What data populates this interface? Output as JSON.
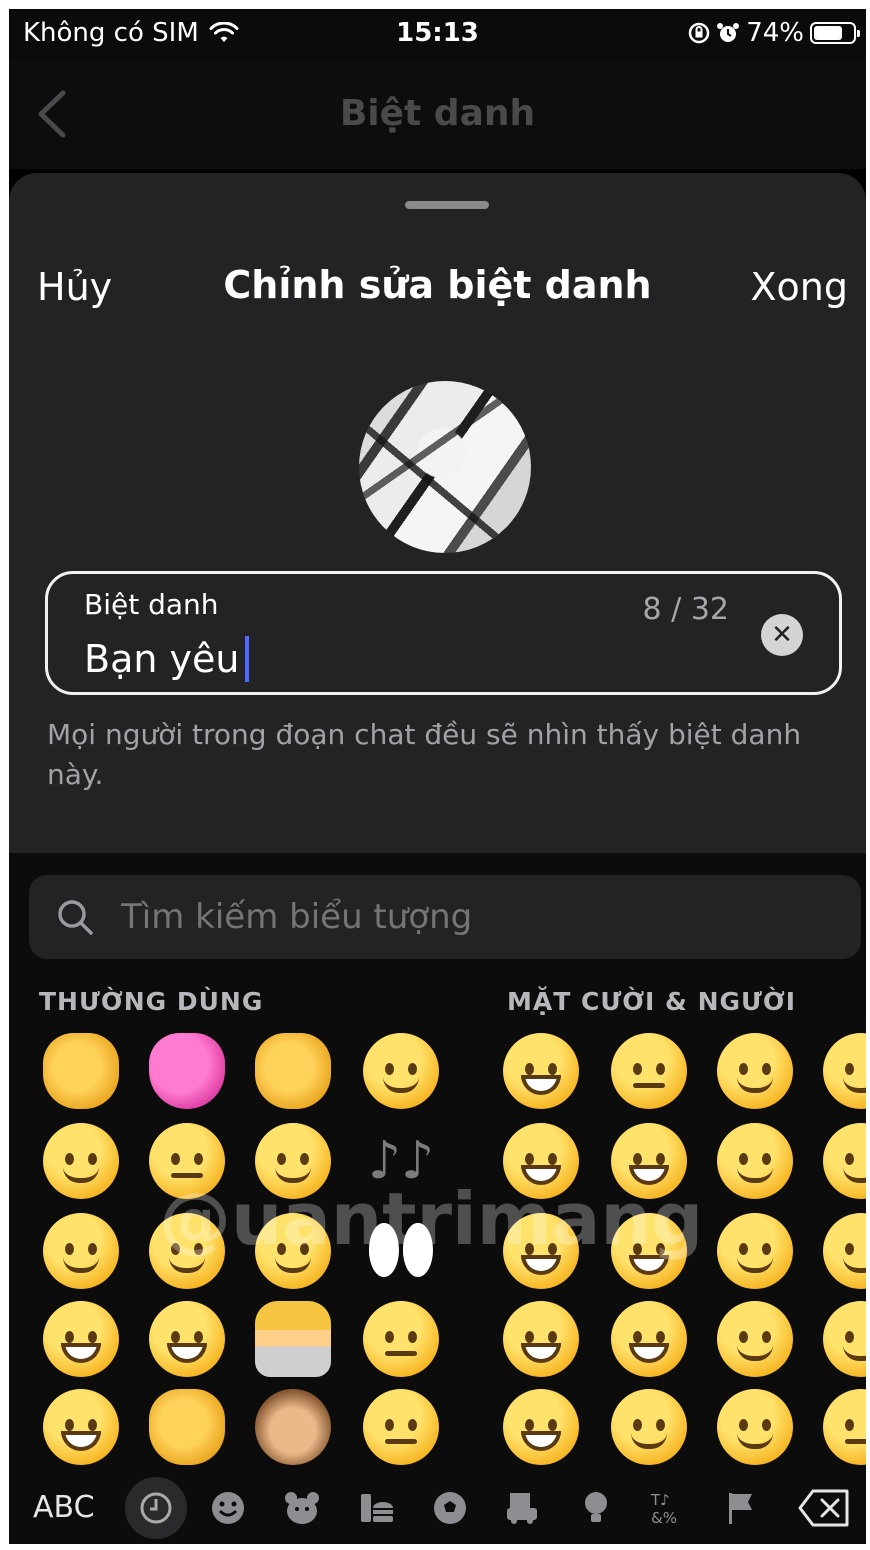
{
  "status_bar": {
    "carrier": "Không có SIM",
    "time": "15:13",
    "battery": "74%",
    "battery_level": 0.74
  },
  "nav": {
    "title": "Biệt danh"
  },
  "sheet": {
    "cancel": "Hủy",
    "title": "Chỉnh sửa biệt danh",
    "done": "Xong"
  },
  "nickname_field": {
    "label": "Biệt danh",
    "value": "Bạn yêu",
    "counter": "8 / 32"
  },
  "hint": "Mọi người trong đoạn chat đều sẽ nhìn thấy biệt danh này.",
  "emoji_keyboard": {
    "search_placeholder": "Tìm kiếm biểu tượng",
    "section_frequent": "THƯỜNG DÙNG",
    "section_smileys": "MẶT CƯỜI & NGƯỜI",
    "abc": "ABC",
    "watermark": "@uantrimang"
  }
}
